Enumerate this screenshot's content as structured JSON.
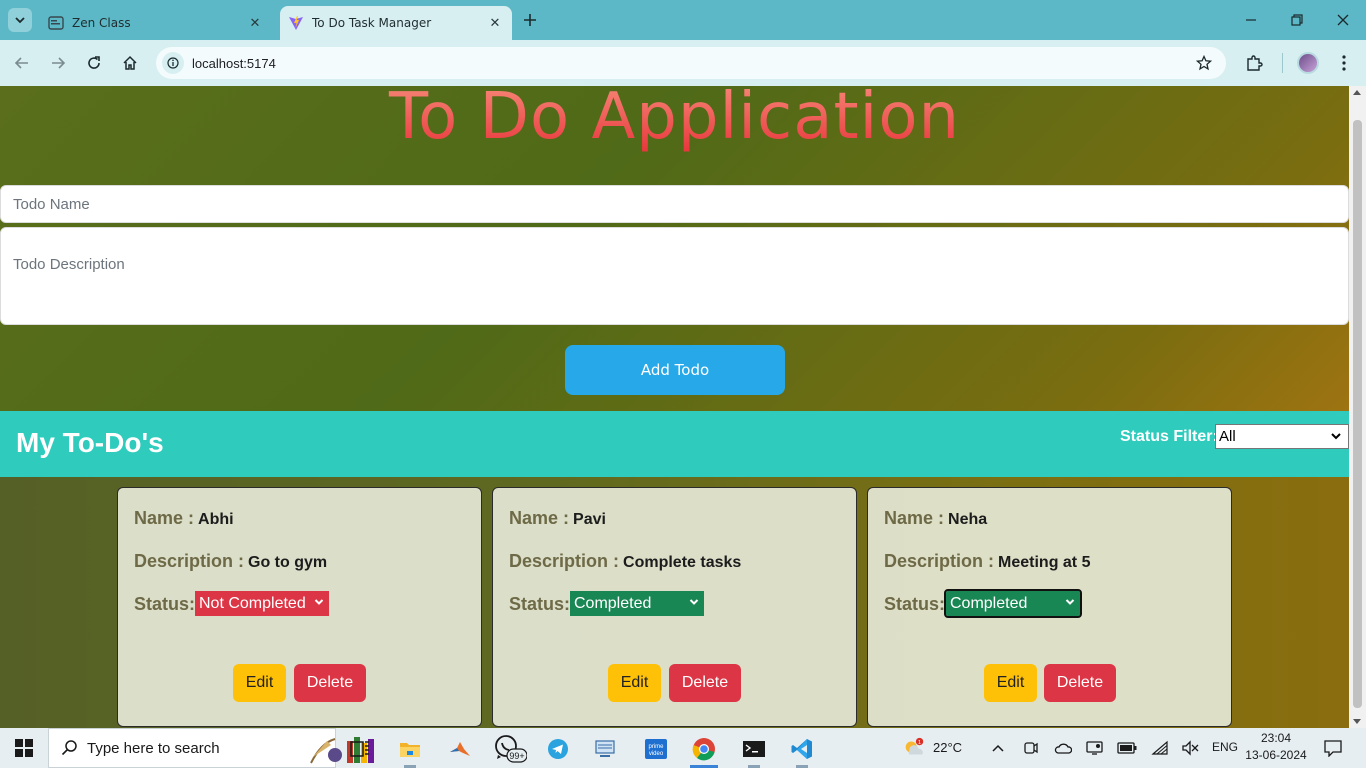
{
  "browser": {
    "tabs": [
      {
        "title": "Zen Class",
        "active": false
      },
      {
        "title": "To Do Task Manager",
        "active": true
      }
    ],
    "url": "localhost:5174"
  },
  "app": {
    "title": "To Do Application",
    "form": {
      "name_placeholder": "Todo Name",
      "name_value": "",
      "description_placeholder": "Todo Description",
      "description_value": "",
      "add_button": "Add Todo"
    },
    "list": {
      "heading": "My To-Do's",
      "filter_label": "Status Filter:",
      "filter_value": "All"
    },
    "labels": {
      "name": "Name :",
      "description": "Description :",
      "status": "Status:",
      "edit": "Edit",
      "delete": "Delete"
    },
    "todos": [
      {
        "name": "Abhi",
        "description": "Go to gym",
        "status": "Not Completed"
      },
      {
        "name": "Pavi",
        "description": "Complete tasks",
        "status": "Completed"
      },
      {
        "name": "Neha",
        "description": "Meeting at 5",
        "status": "Completed"
      }
    ]
  },
  "taskbar": {
    "search_placeholder": "Type here to search",
    "weather": "22°C",
    "language": "ENG",
    "time": "23:04",
    "date": "13-06-2024",
    "whatsapp_badge": "99+",
    "weather_badge": "1"
  },
  "colors": {
    "tabbar": "#5cb8c6",
    "toolbar": "#d8eff2",
    "title_red": "#e8343a",
    "teal_header": "#2fcbbd",
    "add_button": "#27a8e8",
    "not_completed": "#dc3545",
    "completed": "#198754",
    "edit_button": "#ffc107",
    "delete_button": "#dc3545"
  }
}
